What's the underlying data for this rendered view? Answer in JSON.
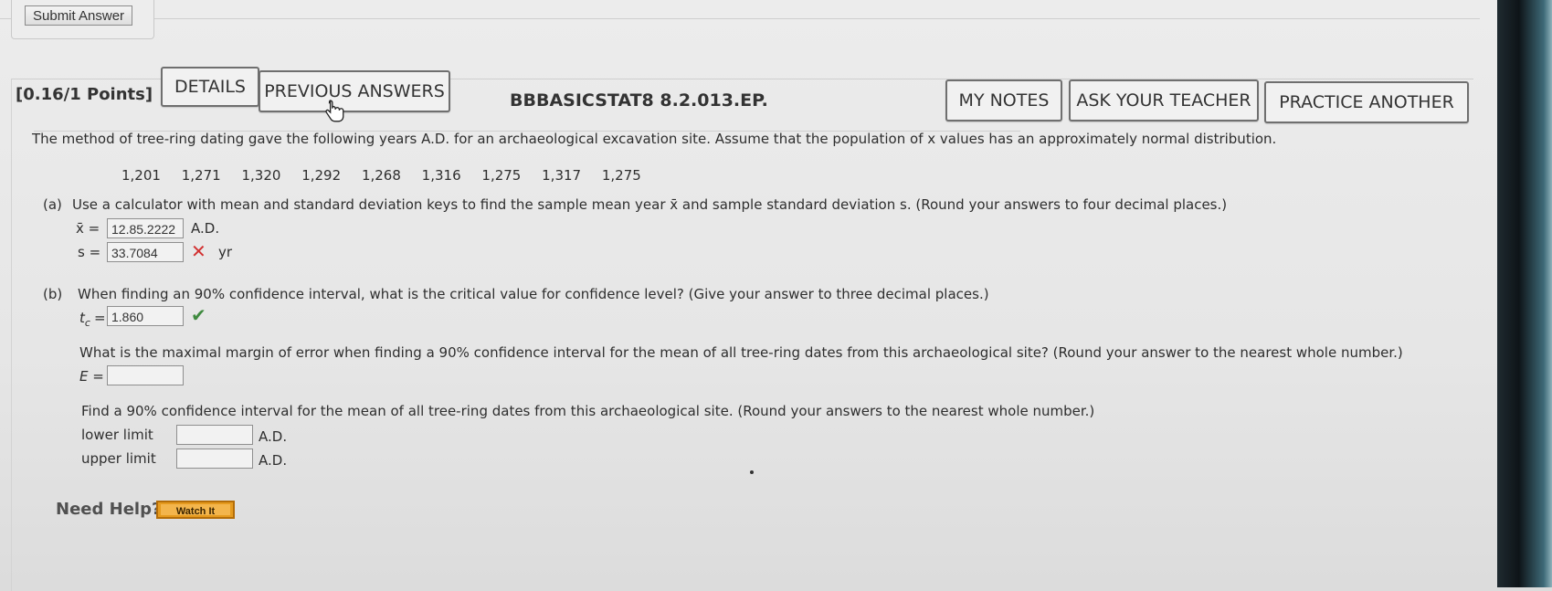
{
  "submit": {
    "label": "Submit Answer"
  },
  "header": {
    "points": "[0.16/1 Points]",
    "details": "DETAILS",
    "previous_answers": "PREVIOUS ANSWERS",
    "question_id": "BBBASICSTAT8 8.2.013.EP.",
    "my_notes": "MY NOTES",
    "ask_teacher": "ASK YOUR TEACHER",
    "practice_another": "PRACTICE ANOTHER"
  },
  "problem": {
    "intro": "The method of tree-ring dating gave the following years A.D. for an archaeological excavation site. Assume that the population of x values has an approximately normal distribution.",
    "data": [
      "1,201",
      "1,271",
      "1,320",
      "1,292",
      "1,268",
      "1,316",
      "1,275",
      "1,317",
      "1,275"
    ]
  },
  "part_a": {
    "label": "(a)",
    "prompt": "Use a calculator with mean and standard deviation keys to find the sample mean year x̄ and sample standard deviation s. (Round your answers to four decimal places.)",
    "xbar_label": "x̄ =",
    "xbar_value": "12.85.2222",
    "xbar_unit": "A.D.",
    "s_label": "s =",
    "s_value": "33.7084",
    "s_status": "incorrect",
    "s_unit": "yr"
  },
  "part_b": {
    "label": "(b)",
    "prompt": "When finding an 90% confidence interval, what is the critical value for confidence level? (Give your answer to three decimal places.)",
    "tc_label": "t",
    "tc_sub": "c",
    "tc_eq": "=",
    "tc_value": "1.860",
    "tc_status": "correct",
    "margin_prompt": "What is the maximal margin of error when finding a 90% confidence interval for the mean of all tree-ring dates from this archaeological site? (Round your answer to the nearest whole number.)",
    "E_label": "E =",
    "E_value": "",
    "ci_prompt": "Find a 90% confidence interval for the mean of all tree-ring dates from this archaeological site. (Round your answers to the nearest whole number.)",
    "lower_label": "lower limit",
    "lower_value": "",
    "lower_unit": "A.D.",
    "upper_label": "upper limit",
    "upper_value": "",
    "upper_unit": "A.D."
  },
  "help": {
    "label": "Need Help?",
    "watch": "Watch It"
  },
  "icons": {
    "incorrect": "x-mark-icon",
    "correct": "checkmark-icon",
    "cursor": "hand-cursor-icon"
  },
  "colors": {
    "incorrect": "#d23131",
    "correct": "#3f8a3f",
    "watch_button": "#e59a1e"
  }
}
